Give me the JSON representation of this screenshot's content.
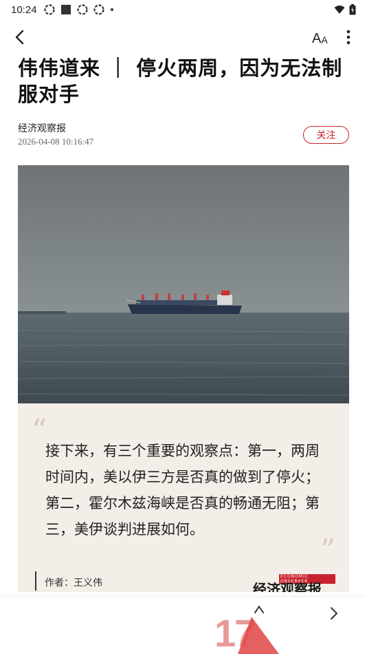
{
  "status_bar": {
    "time": "10:24",
    "icons": [
      "app-icon",
      "square-icon",
      "app-icon",
      "app-icon",
      "dot-icon"
    ],
    "right_icons": [
      "wifi-icon",
      "battery-icon"
    ]
  },
  "nav": {
    "back_icon": "chevron-left-icon",
    "font_size_label_big": "A",
    "font_size_label_small": "A",
    "more_icon": "more-vertical-icon"
  },
  "article": {
    "title": "伟伟道来 ｜ 停火两周，因为无法制服对手",
    "source": "经济观察报",
    "datetime": "2026-04-08 10:16:47",
    "follow_label": "关注"
  },
  "quote_card": {
    "open_mark": "“",
    "close_mark": "”",
    "text": "接下来，有三个重要的观察点：第一，两周时间内，美以伊三方是否真的做到了停火；第二，霍尔木兹海峡是否真的畅通无阻；第三，美伊谈判进展如何。",
    "author": "作者：王义伟",
    "logo_text": "经济观察报",
    "logo_small": "ECONOMIC OBSERVER"
  },
  "bottom_bar": {
    "like_count": "17",
    "up_icon": "arrow-up-icon",
    "share_icon": "share-icon"
  },
  "colors": {
    "accent": "#c8232c",
    "card_bg": "#f3eee8"
  }
}
